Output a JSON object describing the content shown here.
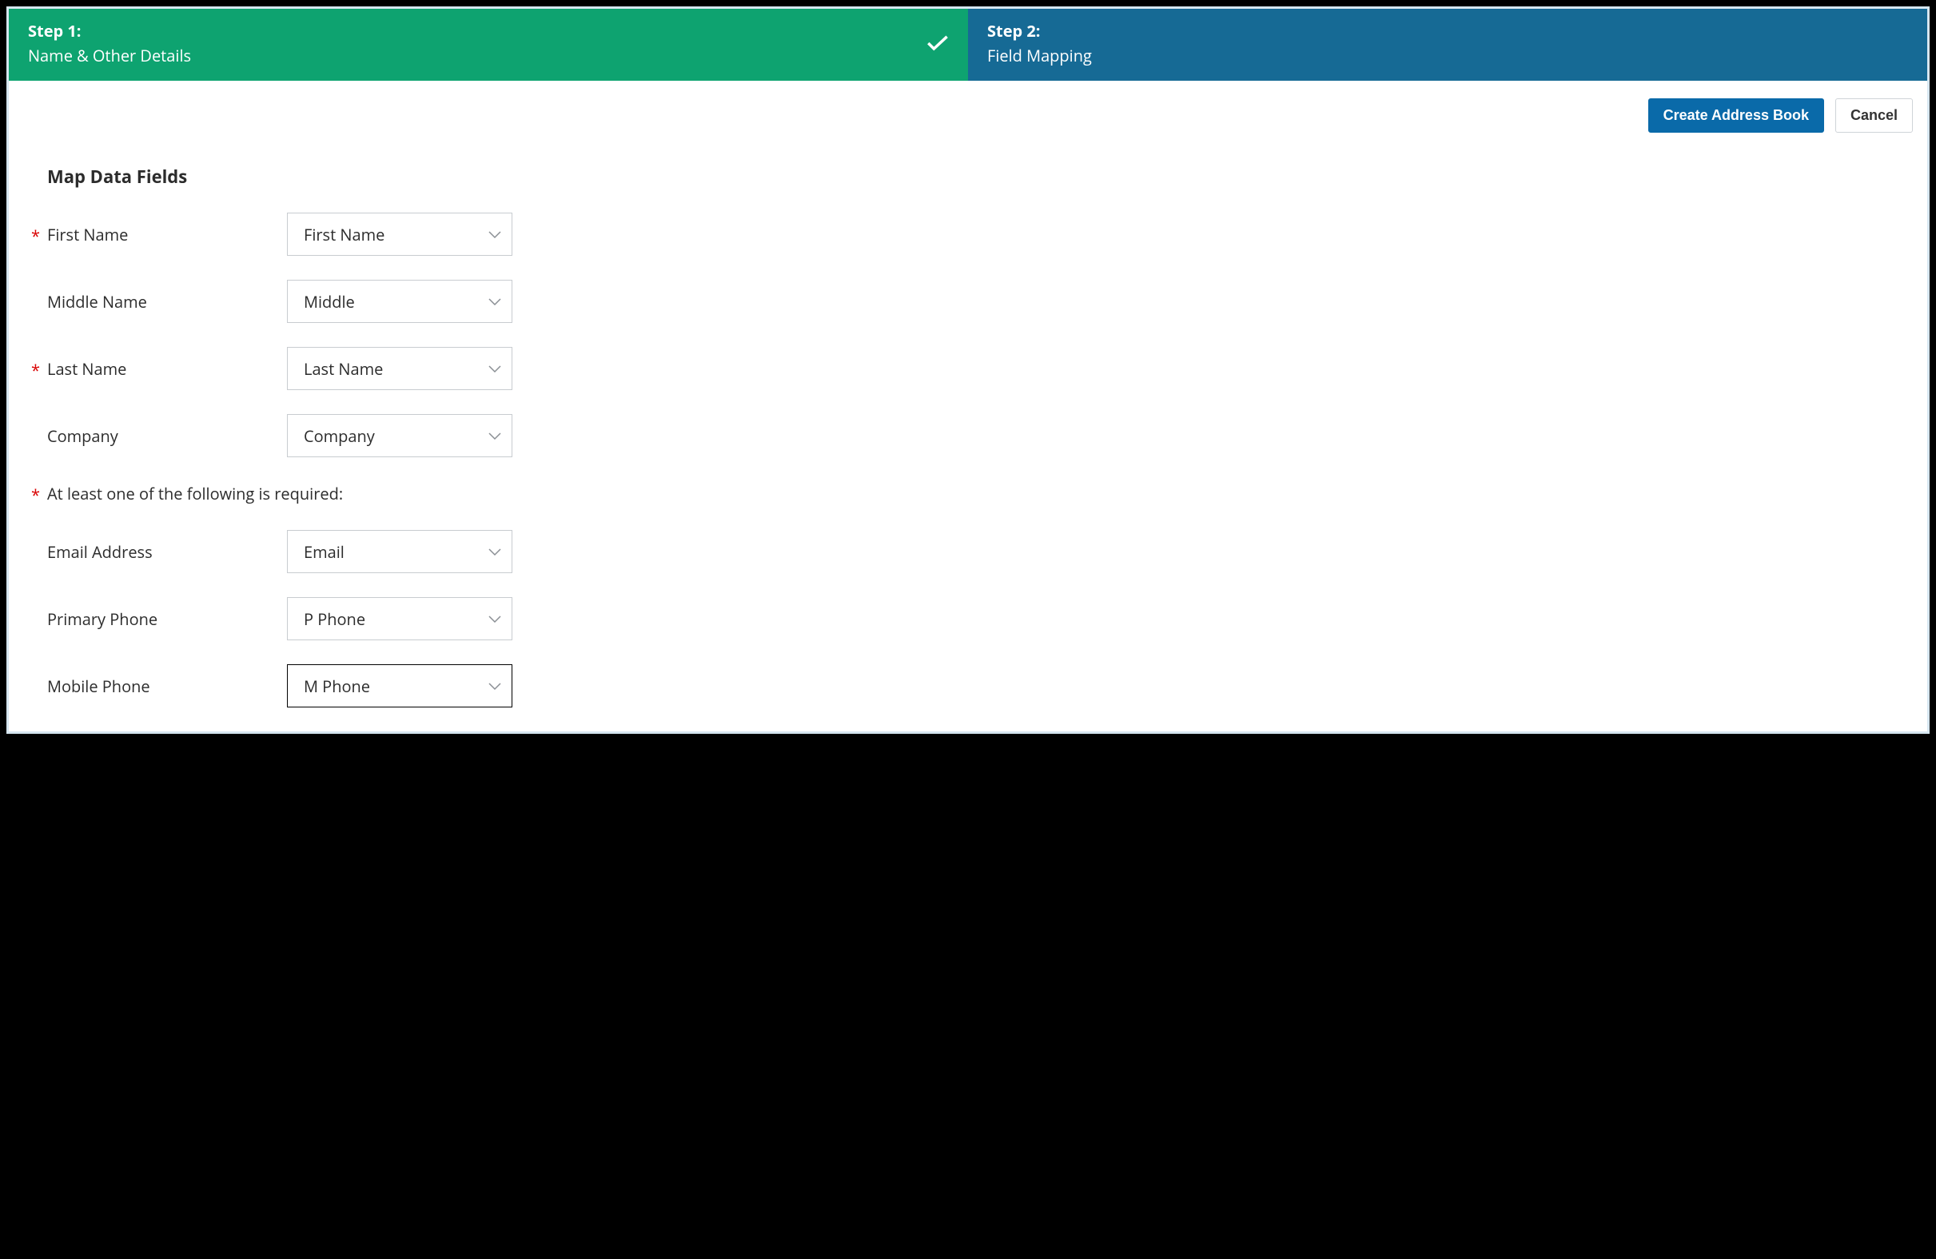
{
  "steps": {
    "step1": {
      "title": "Step 1:",
      "subtitle": "Name & Other Details"
    },
    "step2": {
      "title": "Step 2:",
      "subtitle": "Field Mapping"
    }
  },
  "actions": {
    "primary": "Create Address Book",
    "secondary": "Cancel"
  },
  "section_title": "Map Data Fields",
  "note": "At least one of the following is required:",
  "asterisk": "*",
  "fields": {
    "first_name": {
      "label": "First Name",
      "value": "First Name",
      "required": true
    },
    "middle_name": {
      "label": "Middle Name",
      "value": "Middle",
      "required": false
    },
    "last_name": {
      "label": "Last Name",
      "value": "Last Name",
      "required": true
    },
    "company": {
      "label": "Company",
      "value": "Company",
      "required": false
    },
    "email": {
      "label": "Email Address",
      "value": "Email",
      "required": false
    },
    "primary_phone": {
      "label": "Primary Phone",
      "value": "P Phone",
      "required": false
    },
    "mobile_phone": {
      "label": "Mobile Phone",
      "value": "M Phone",
      "required": false
    }
  }
}
